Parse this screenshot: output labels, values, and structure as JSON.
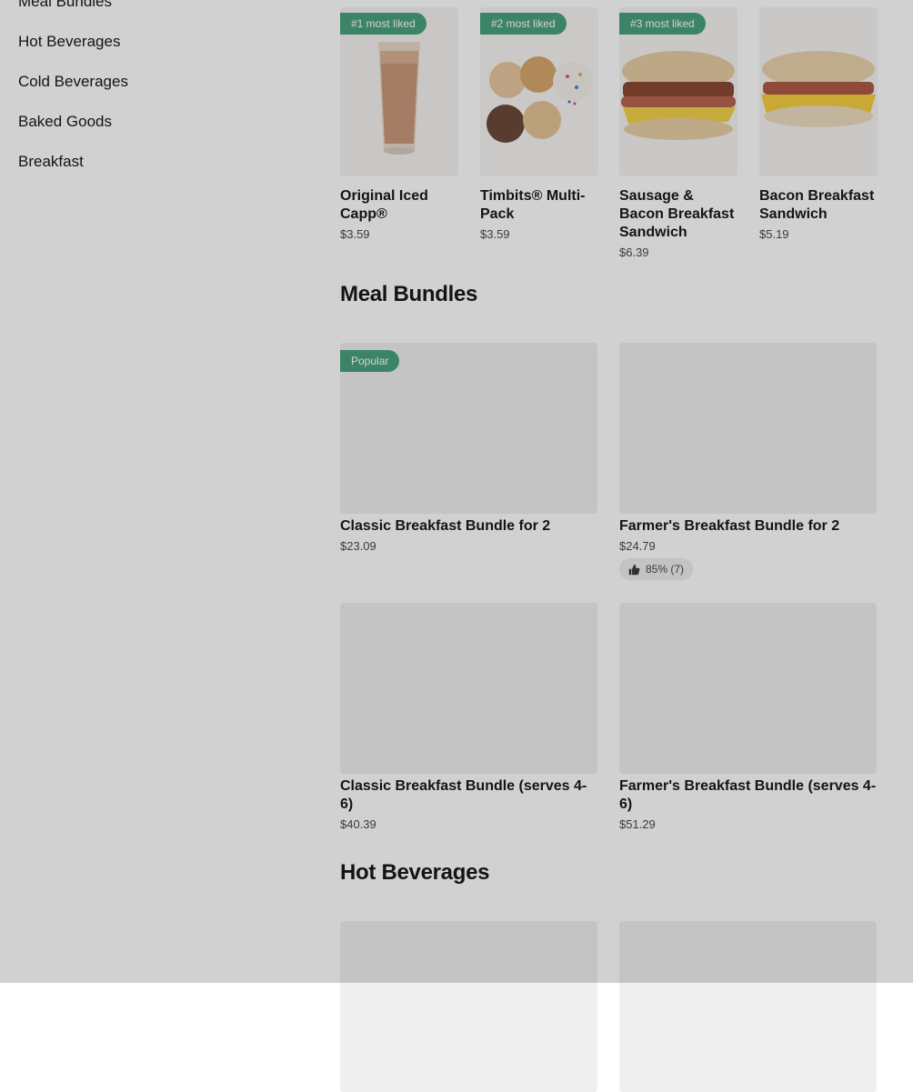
{
  "sidebar": {
    "items": [
      {
        "label": "Meal Bundles"
      },
      {
        "label": "Hot Beverages"
      },
      {
        "label": "Cold Beverages"
      },
      {
        "label": "Baked Goods"
      },
      {
        "label": "Breakfast"
      }
    ]
  },
  "popular": {
    "items": [
      {
        "badge": "#1 most liked",
        "title": "Original Iced Capp®",
        "price": "$3.59"
      },
      {
        "badge": "#2 most liked",
        "title": "Timbits® Multi-Pack",
        "price": "$3.59"
      },
      {
        "badge": "#3 most liked",
        "title": "Sausage & Bacon Breakfast Sandwich",
        "price": "$6.39"
      },
      {
        "badge": "",
        "title": "Bacon Breakfast Sandwich",
        "price": "$5.19"
      }
    ]
  },
  "meal_bundles": {
    "title": "Meal Bundles",
    "items": [
      {
        "badge": "Popular",
        "title": "Classic Breakfast Bundle for 2",
        "price": "$23.09"
      },
      {
        "badge": "",
        "title": "Farmer's Breakfast Bundle for 2",
        "price": "$24.79",
        "rating": "85% (7)"
      },
      {
        "badge": "",
        "title": "Classic Breakfast Bundle (serves 4-6)",
        "price": "$40.39"
      },
      {
        "badge": "",
        "title": "Farmer's Breakfast Bundle (serves 4-6)",
        "price": "$51.29"
      }
    ]
  },
  "hot_beverages": {
    "title": "Hot Beverages"
  },
  "colors": {
    "badge_green": "#4aa27e",
    "overlay": "rgba(0,0,0,0.18)"
  }
}
